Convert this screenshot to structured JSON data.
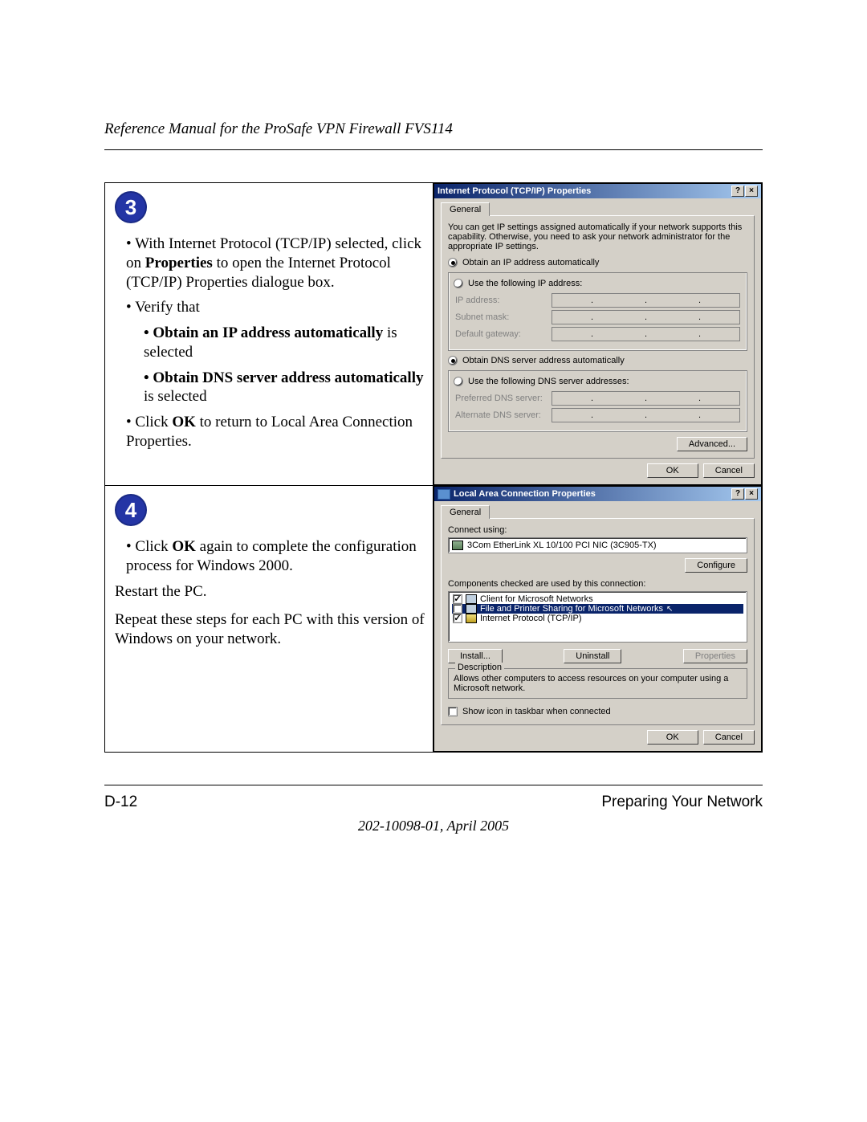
{
  "header": {
    "title": "Reference Manual for the ProSafe VPN Firewall FVS114"
  },
  "step3": {
    "num": "3",
    "b1_pre": "With Internet Protocol (TCP/IP) selected, click on ",
    "b1_bold": "Properties",
    "b1_post": " to open the Internet Protocol (TCP/IP) Properties dialogue box.",
    "b2": "Verify that",
    "b2a_bold": "Obtain an IP address automatically",
    "b2a_post": " is selected",
    "b2b_bold": "Obtain DNS server address automatically",
    "b2b_post": " is selected",
    "b3_pre": "Click ",
    "b3_bold": "OK",
    "b3_post": " to return to Local Area Connection Properties."
  },
  "step4": {
    "num": "4",
    "b1_pre": "Click ",
    "b1_bold": "OK",
    "b1_post": " again to complete the configuration process for Windows 2000.",
    "p1": "Restart the PC.",
    "p2": "Repeat these steps for each PC with this version of Windows on your network."
  },
  "tcpip": {
    "title": "Internet Protocol (TCP/IP) Properties",
    "tab": "General",
    "intro": "You can get IP settings assigned automatically if your network supports this capability. Otherwise, you need to ask your network administrator for the appropriate IP settings.",
    "ip_auto": "Obtain an IP address automatically",
    "ip_manual": "Use the following IP address:",
    "ip_label": "IP address:",
    "mask_label": "Subnet mask:",
    "gw_label": "Default gateway:",
    "dns_auto": "Obtain DNS server address automatically",
    "dns_manual": "Use the following DNS server addresses:",
    "pdns_label": "Preferred DNS server:",
    "adns_label": "Alternate DNS server:",
    "advanced": "Advanced...",
    "ok": "OK",
    "cancel": "Cancel"
  },
  "lac": {
    "title": "Local Area Connection Properties",
    "tab": "General",
    "connect_using": "Connect using:",
    "adapter": "3Com EtherLink XL 10/100 PCI NIC (3C905-TX)",
    "configure": "Configure",
    "components_label": "Components checked are used by this connection:",
    "item1": "Client for Microsoft Networks",
    "item2": "File and Printer Sharing for Microsoft Networks",
    "item3": "Internet Protocol (TCP/IP)",
    "install": "Install...",
    "uninstall": "Uninstall",
    "properties": "Properties",
    "desc_legend": "Description",
    "desc_text": "Allows other computers to access resources on your computer using a Microsoft network.",
    "show_icon": "Show icon in taskbar when connected",
    "ok": "OK",
    "cancel": "Cancel"
  },
  "footer": {
    "page": "D-12",
    "section": "Preparing Your Network",
    "docline": "202-10098-01, April 2005"
  }
}
